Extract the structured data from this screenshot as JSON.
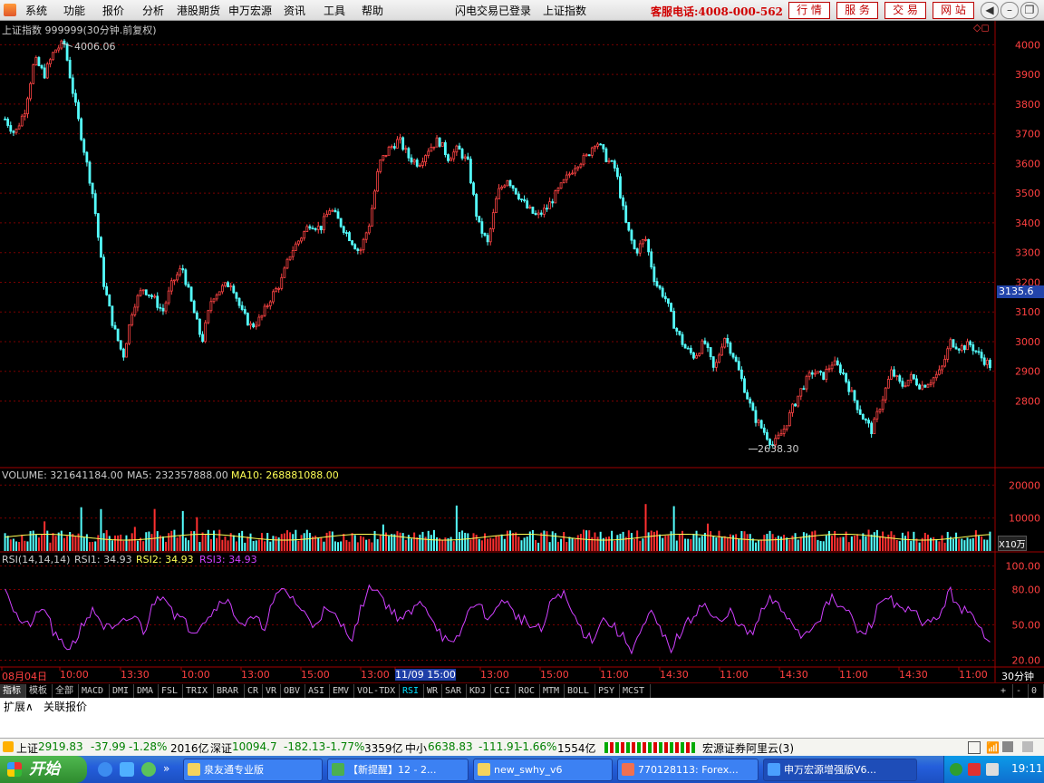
{
  "menu": {
    "items": [
      "系统",
      "功能",
      "报价",
      "分析",
      "港股期货",
      "申万宏源",
      "资讯",
      "工具",
      "帮助"
    ],
    "status_login": "闪电交易已登录",
    "current_index": "上证指数",
    "hotline": "客服电话:4008-000-562",
    "buttons": [
      "行 情",
      "服 务",
      "交 易",
      "网 站"
    ]
  },
  "chart_header": {
    "title": "上证指数 999999(30分钟.前复权)",
    "high_label": "4006.06",
    "low_label": "2638.30",
    "current_price": "3135.6"
  },
  "volume_header": {
    "volume": "VOLUME: 321641184.00",
    "ma5": "MA5: 232357888.00",
    "ma10": "MA10: 268881088.00",
    "unit": "X10万"
  },
  "rsi_header": {
    "name": "RSI(14,14,14)",
    "rsi1": "RSI1: 34.93",
    "rsi2": "RSI2: 34.93",
    "rsi3": "RSI3: 34.93"
  },
  "x_axis": {
    "labels": [
      "08月04日",
      "10:00",
      "13:30",
      "10:00",
      "13:00",
      "15:00",
      "13:00",
      "11/09 15:00",
      "13:00",
      "15:00",
      "11:00",
      "14:30",
      "11:00",
      "14:30",
      "11:00",
      "14:30",
      "11:00"
    ],
    "period": "30分钟"
  },
  "indicator_tabs": [
    "指标",
    "模板",
    "全部",
    "MACD",
    "DMI",
    "DMA",
    "FSL",
    "TRIX",
    "BRAR",
    "CR",
    "VR",
    "OBV",
    "ASI",
    "EMV",
    "VOL-TDX",
    "RSI",
    "WR",
    "SAR",
    "KDJ",
    "CCI",
    "ROC",
    "MTM",
    "BOLL",
    "PSY",
    "MCST"
  ],
  "tab_controls": [
    "+",
    "-",
    "0"
  ],
  "expand_tabs": [
    "扩展∧",
    "关联报价"
  ],
  "status_bar": {
    "sh": {
      "name": "上证",
      "value": "2919.83",
      "change": "-37.99",
      "pct": "-1.28%",
      "amount": "2016亿"
    },
    "sz": {
      "name": "深证",
      "value": "10094.7",
      "change": "-182.13",
      "pct": "-1.77%",
      "amount": "3359亿"
    },
    "zx": {
      "name": "中小",
      "value": "6638.83",
      "change": "-111.91",
      "pct": "-1.66%",
      "amount": "1554亿"
    },
    "server": "宏源证券阿里云(3)"
  },
  "taskbar": {
    "start": "开始",
    "tasks": [
      "泉友通专业版",
      "【新提醒】12 - 2...",
      "new_swhy_v6",
      "770128113: Forex...",
      "申万宏源增强版V6..."
    ],
    "clock": "19:11"
  },
  "chart_data": [
    {
      "type": "candlestick",
      "title": "上证指数 999999(30分钟.前复权)",
      "ylim": [
        2600,
        4050
      ],
      "yticks": [
        2800,
        2900,
        3000,
        3100,
        3200,
        3300,
        3400,
        3500,
        3600,
        3700,
        3800,
        3900,
        4000
      ],
      "annotations": [
        {
          "label": "4006.06",
          "type": "high"
        },
        {
          "label": "2638.30",
          "type": "low"
        },
        {
          "label": "3135.6",
          "type": "last"
        }
      ],
      "close_path": [
        3750,
        3700,
        3780,
        3950,
        3900,
        3980,
        4006,
        3820,
        3650,
        3480,
        3200,
        3050,
        2950,
        3120,
        3180,
        3150,
        3100,
        3200,
        3250,
        3120,
        3000,
        3150,
        3180,
        3200,
        3100,
        3050,
        3080,
        3150,
        3200,
        3300,
        3350,
        3400,
        3380,
        3450,
        3400,
        3350,
        3300,
        3400,
        3600,
        3650,
        3680,
        3620,
        3600,
        3650,
        3680,
        3620,
        3650,
        3600,
        3400,
        3330,
        3500,
        3550,
        3500,
        3450,
        3420,
        3450,
        3500,
        3550,
        3600,
        3620,
        3680,
        3620,
        3580,
        3400,
        3300,
        3350,
        3200,
        3150,
        3050,
        2980,
        2950,
        3000,
        2900,
        3020,
        2950,
        2850,
        2750,
        2700,
        2650,
        2700,
        2780,
        2850,
        2900,
        2880,
        2930,
        2900,
        2820,
        2750,
        2700,
        2800,
        2900,
        2850,
        2880,
        2850,
        2870,
        2900,
        3000,
        2980,
        2990,
        2950,
        2920
      ]
    },
    {
      "type": "bar",
      "title": "VOLUME",
      "ylim": [
        0,
        22000
      ],
      "yticks": [
        10000,
        20000
      ],
      "unit": "X10万"
    },
    {
      "type": "line",
      "title": "RSI(14,14,14)",
      "ylim": [
        15,
        105
      ],
      "yticks": [
        20.0,
        50.0,
        80.0,
        100.0
      ],
      "series": [
        {
          "name": "RSI1",
          "values": [
            85,
            60,
            48,
            55,
            65,
            40,
            30,
            35,
            55,
            62,
            48,
            45,
            52,
            58,
            44,
            70,
            78,
            60,
            52,
            45,
            55,
            62,
            75,
            60,
            50,
            55,
            48,
            70,
            80,
            72,
            60,
            50,
            62,
            58,
            48,
            40,
            70,
            85,
            72,
            60,
            55,
            62,
            70,
            55,
            40,
            30,
            48,
            70,
            62,
            55,
            75,
            60,
            55,
            48,
            45,
            72,
            78,
            60,
            45,
            38,
            55,
            50,
            40,
            30,
            45,
            60,
            42,
            30,
            45,
            55,
            70,
            58,
            50,
            62,
            48,
            40,
            60,
            72,
            62,
            55,
            40,
            48,
            58,
            72,
            65,
            58,
            40,
            50,
            70,
            75,
            60,
            62,
            55,
            50,
            60,
            78,
            65,
            58,
            45,
            40
          ]
        }
      ]
    }
  ]
}
